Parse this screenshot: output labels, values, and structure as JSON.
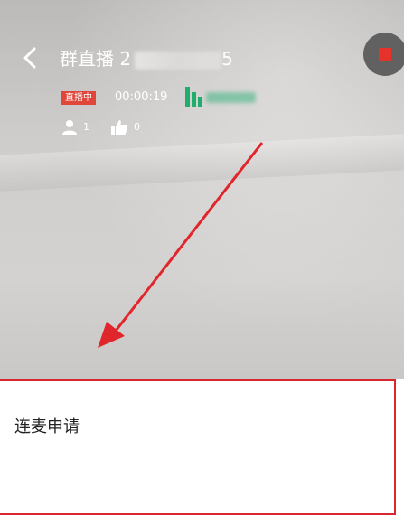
{
  "header": {
    "title": "群直播 2",
    "title_suffix": "5",
    "back_icon": "chevron-left-icon",
    "stop_icon": "stop-square-icon"
  },
  "status": {
    "live_badge": "直播中",
    "duration": "00:00:19",
    "signal_icon": "signal-bars-icon"
  },
  "stats": {
    "viewers": "1",
    "likes": "0",
    "viewer_icon": "user-icon",
    "like_icon": "thumbs-up-icon"
  },
  "panel": {
    "title": "连麦申请"
  },
  "colors": {
    "accent_red": "#e0473a",
    "signal_green": "#1fae6e",
    "annotation_red": "#d7262e"
  }
}
